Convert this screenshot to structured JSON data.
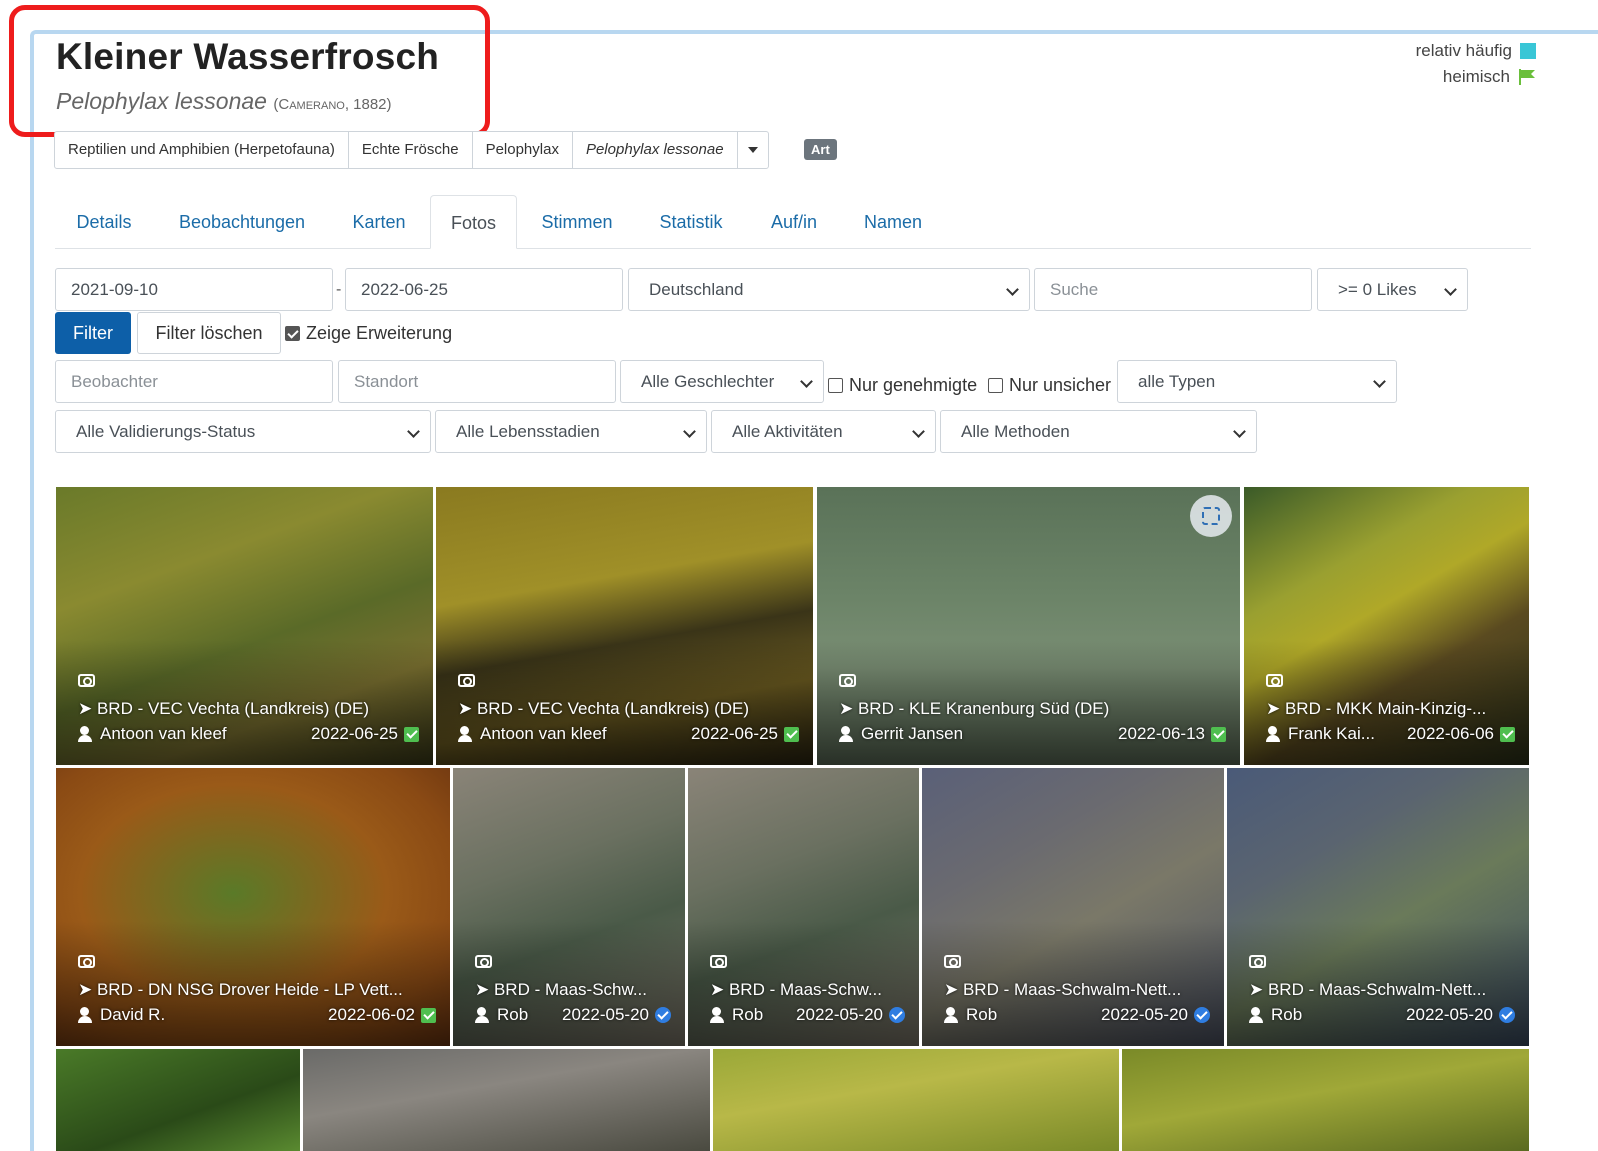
{
  "species": {
    "common_name": "Kleiner Wasserfrosch",
    "scientific_name": "Pelophylax lessonae",
    "author": "(Camerano, 1882)"
  },
  "status": {
    "frequency": "relativ häufig",
    "frequency_color": "#39c6d6",
    "origin": "heimisch",
    "origin_color": "#6abf3b"
  },
  "breadcrumb": {
    "items": [
      "Reptilien und Amphibien (Herpetofauna)",
      "Echte Frösche",
      "Pelophylax",
      "Pelophylax lessonae"
    ],
    "rank": "Art"
  },
  "tabs": [
    "Details",
    "Beobachtungen",
    "Karten",
    "Fotos",
    "Stimmen",
    "Statistik",
    "Auf/in",
    "Namen"
  ],
  "active_tab": "Fotos",
  "filters": {
    "date_from": "2021-09-10",
    "date_to": "2022-06-25",
    "country": "Deutschland",
    "search_placeholder": "Suche",
    "likes": ">= 0 Likes",
    "filter_button": "Filter",
    "clear_button": "Filter löschen",
    "show_extension": "Zeige Erweiterung",
    "observer_placeholder": "Beobachter",
    "location_placeholder": "Standort",
    "sex": "Alle Geschlechter",
    "only_approved": "Nur genehmigte",
    "only_uncertain": "Nur unsicher",
    "types": "alle Typen",
    "validation": "Alle Validierungs-Status",
    "life_stages": "Alle Lebensstadien",
    "activities": "Alle Aktivitäten",
    "methods": "Alle Methoden"
  },
  "photos": [
    {
      "location": "BRD - VEC Vechta (Landkreis) (DE)",
      "observer": "Antoon van kleef",
      "date": "2022-06-25",
      "status": "approved"
    },
    {
      "location": "BRD - VEC Vechta (Landkreis) (DE)",
      "observer": "Antoon van kleef",
      "date": "2022-06-25",
      "status": "approved"
    },
    {
      "location": "BRD - KLE Kranenburg Süd (DE)",
      "observer": "Gerrit Jansen",
      "date": "2022-06-13",
      "status": "approved"
    },
    {
      "location": "BRD - MKK Main-Kinzig-...",
      "observer": "Frank Kai...",
      "date": "2022-06-06",
      "status": "approved"
    },
    {
      "location": "BRD - DN NSG Drover Heide - LP Vett...",
      "observer": "David R.",
      "date": "2022-06-02",
      "status": "approved"
    },
    {
      "location": "BRD - Maas-Schw...",
      "observer": "Rob",
      "date": "2022-05-20",
      "status": "verified"
    },
    {
      "location": "BRD - Maas-Schw...",
      "observer": "Rob",
      "date": "2022-05-20",
      "status": "verified"
    },
    {
      "location": "BRD - Maas-Schwalm-Nett...",
      "observer": "Rob",
      "date": "2022-05-20",
      "status": "verified"
    },
    {
      "location": "BRD - Maas-Schwalm-Nett...",
      "observer": "Rob",
      "date": "2022-05-20",
      "status": "verified"
    }
  ]
}
